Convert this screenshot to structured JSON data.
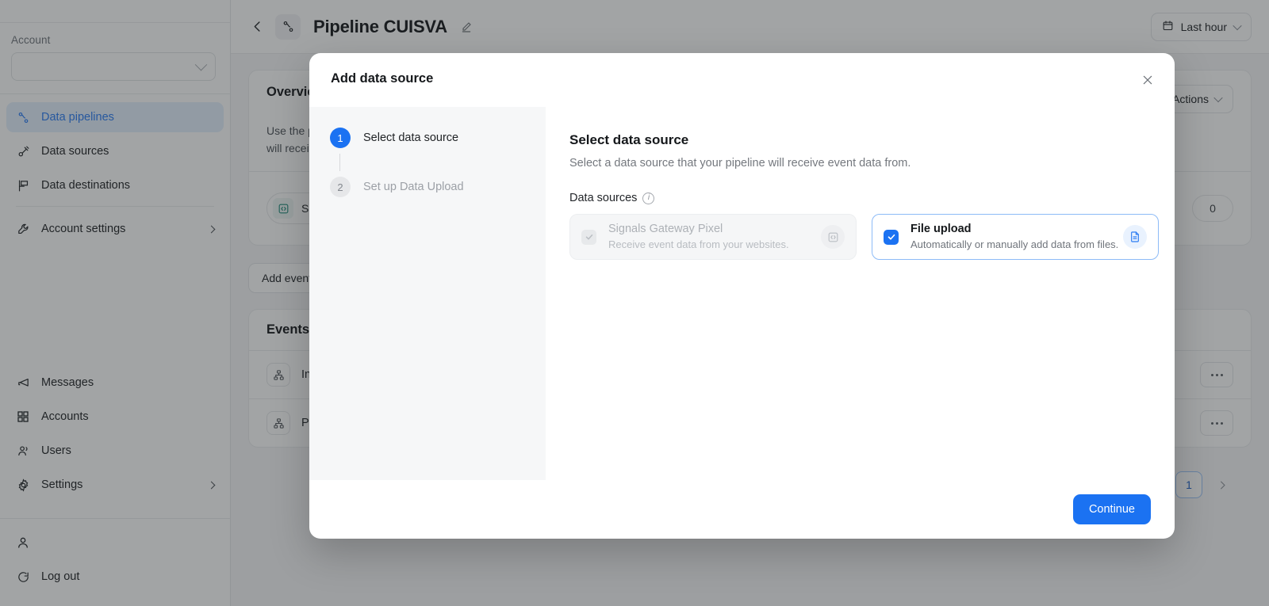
{
  "sidebar": {
    "account_label": "Account",
    "account_value": "",
    "nav_primary": [
      {
        "label": "Data pipelines",
        "icon": "pipeline-icon",
        "active": true
      },
      {
        "label": "Data sources",
        "icon": "plug-icon",
        "active": false
      },
      {
        "label": "Data destinations",
        "icon": "flag-icon",
        "active": false
      }
    ],
    "nav_settings": {
      "label": "Account settings",
      "icon": "wrench-icon"
    },
    "nav_secondary": [
      {
        "label": "Messages",
        "icon": "megaphone-icon"
      },
      {
        "label": "Accounts",
        "icon": "grid-icon"
      },
      {
        "label": "Users",
        "icon": "users-icon"
      },
      {
        "label": "Settings",
        "icon": "gear-icon",
        "chevron": true
      }
    ],
    "logout_label": "Log out"
  },
  "topbar": {
    "title": "Pipeline CUISVA",
    "back_icon": "back-arrow-icon",
    "pipeline_icon": "pipeline-icon",
    "edit_icon": "pencil-icon",
    "range_label": "Last hour",
    "range_icon": "calendar-icon"
  },
  "background": {
    "overview_title": "Overview",
    "overview_desc_line1": "Use the pipeline to connect data sources with destinations. Data collected from sources",
    "overview_desc_line2": "will receive event data and route it onward.",
    "actions_label": "Actions",
    "source_chip": "Signals Gateway Pixel",
    "source_count": "0",
    "add_event_label": "Add event",
    "events_title": "Events",
    "events": [
      {
        "name": "Input event"
      },
      {
        "name": "Page view"
      }
    ],
    "dots_label": "...",
    "page_number": "1"
  },
  "modal": {
    "title": "Add data source",
    "close_icon": "close-icon",
    "steps": [
      {
        "number": "1",
        "label": "Select data source",
        "state": "active"
      },
      {
        "number": "2",
        "label": "Set up Data Upload",
        "state": "pending"
      }
    ],
    "panel": {
      "title": "Select data source",
      "subtitle": "Select a data source that your pipeline will receive event data from.",
      "field_label": "Data sources",
      "field_info_icon": "info-icon",
      "sources": [
        {
          "name": "Signals Gateway Pixel",
          "description": "Receive event data from your websites.",
          "badge_icon": "code-icon",
          "selected": false,
          "disabled": true
        },
        {
          "name": "File upload",
          "description": "Automatically or manually add data from files.",
          "badge_icon": "file-icon",
          "selected": true,
          "disabled": false
        }
      ]
    },
    "continue_label": "Continue"
  },
  "colors": {
    "accent": "#1b72f2",
    "accent_soft": "#e4f0fe",
    "canvas": "#f6f7f9",
    "teal": "#1f8a7a"
  }
}
